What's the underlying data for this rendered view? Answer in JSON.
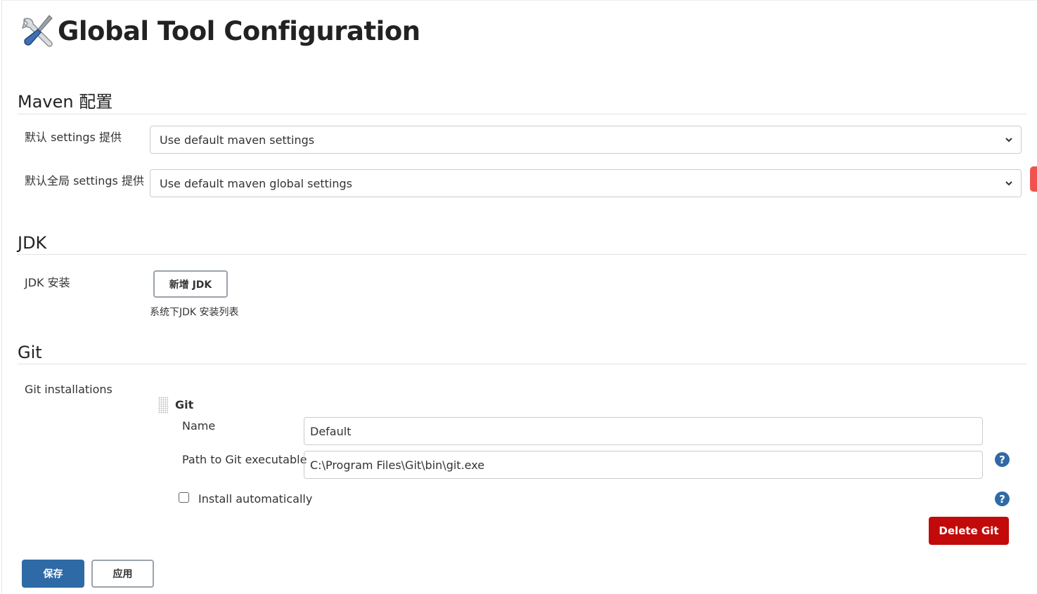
{
  "page": {
    "title": "Global Tool Configuration",
    "title_icon": "wrench-screwdriver-icon"
  },
  "maven": {
    "heading": "Maven 配置",
    "settings_label": "默认 settings 提供",
    "settings_value": "Use default maven settings",
    "global_settings_label": "默认全局 settings 提供",
    "global_settings_value": "Use default maven global settings"
  },
  "jdk": {
    "heading": "JDK",
    "install_label": "JDK 安装",
    "add_button": "新增 JDK",
    "description": "系统下JDK 安装列表"
  },
  "git": {
    "heading": "Git",
    "installations_label": "Git installations",
    "item_title": "Git",
    "name_label": "Name",
    "name_value": "Default",
    "path_label": "Path to Git executable",
    "path_value": "C:\\Program Files\\Git\\bin\\git.exe",
    "install_auto_label": "Install automatically",
    "install_auto_checked": false,
    "help_glyph": "?",
    "delete_button": "Delete Git"
  },
  "footer": {
    "save_button": "保存",
    "apply_button": "应用"
  },
  "colors": {
    "primary": "#2e6aa5",
    "danger": "#c30a0a",
    "help": "#2f6aa6"
  }
}
